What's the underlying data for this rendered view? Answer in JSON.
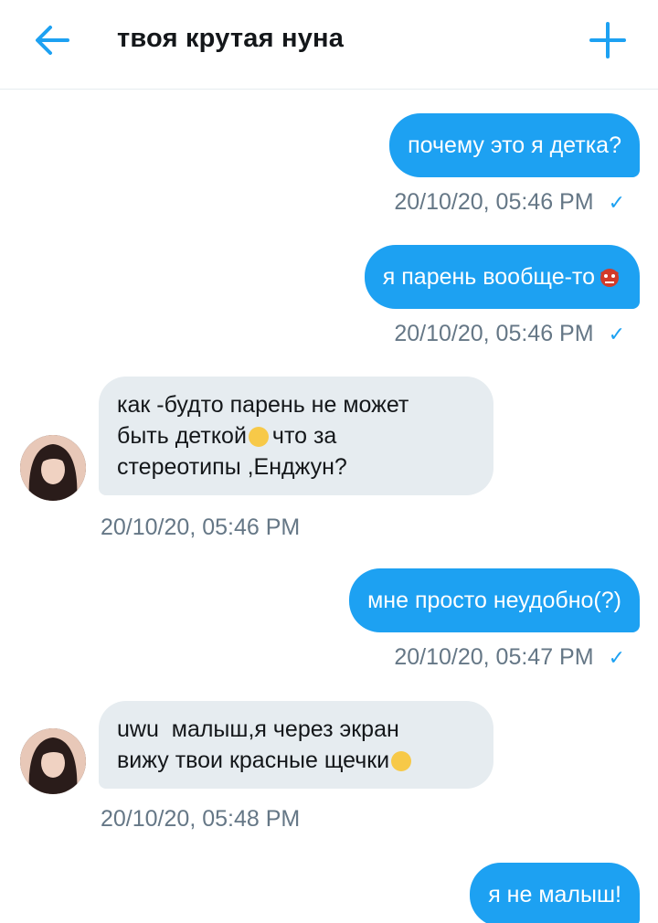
{
  "header": {
    "title": "твоя крутая нуна",
    "back_icon": "arrow-left-icon",
    "add_icon": "plus-icon",
    "accent": "#1da1f2"
  },
  "messages": [
    {
      "dir": "out",
      "text": "почему это я детка?",
      "time": "20/10/20, 05:46 PM"
    },
    {
      "dir": "out",
      "text": "я парень вообще-то",
      "emoji": "goblin-emoji",
      "time": "20/10/20, 05:46 PM"
    },
    {
      "dir": "in",
      "lines": [
        "как -будто парень не может",
        "быть деткой",
        "что за",
        "стереотипы ,Енджун?"
      ],
      "emoji": "eye-roll-emoji",
      "time": "20/10/20, 05:46 PM"
    },
    {
      "dir": "out",
      "text": "мне просто неудобно(?)",
      "time": "20/10/20, 05:47 PM"
    },
    {
      "dir": "in",
      "lines": [
        "uwu  малыш,я через экран",
        "вижу твои красные щечки"
      ],
      "emoji": "kissing-emoji",
      "time": "20/10/20, 05:48 PM"
    },
    {
      "dir": "out",
      "text": "я не малыш!"
    }
  ],
  "colors": {
    "outgoing_bubble": "#1da1f2",
    "incoming_bubble": "#e6ecf0",
    "timestamp": "#657786"
  }
}
